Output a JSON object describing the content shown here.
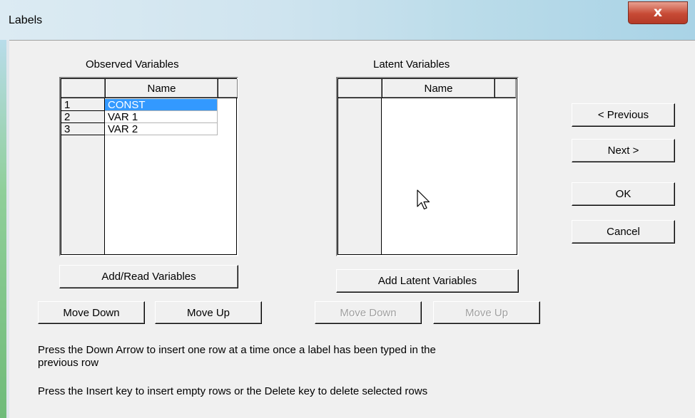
{
  "window": {
    "title": "Labels",
    "close_glyph": "x"
  },
  "observed": {
    "heading": "Observed Variables",
    "column_header": "Name",
    "rows": [
      {
        "num": "1",
        "name": "CONST",
        "selected": true
      },
      {
        "num": "2",
        "name": "VAR 1",
        "selected": false
      },
      {
        "num": "3",
        "name": "VAR 2",
        "selected": false
      }
    ],
    "add_button": "Add/Read Variables",
    "move_down": "Move Down",
    "move_up": "Move Up"
  },
  "latent": {
    "heading": "Latent Variables",
    "column_header": "Name",
    "add_button": "Add Latent Variables",
    "move_down": "Move Down",
    "move_up": "Move Up"
  },
  "nav": {
    "previous": "< Previous",
    "next": "Next >",
    "ok": "OK",
    "cancel": "Cancel"
  },
  "notes": {
    "line1": "Press the Down Arrow to insert one row at a time once a label has been typed in the",
    "line2": "previous row",
    "line3": "Press the Insert key to insert empty rows or the Delete key to delete selected rows"
  },
  "colors": {
    "selection": "#3399ff",
    "close": "#c74a35"
  }
}
